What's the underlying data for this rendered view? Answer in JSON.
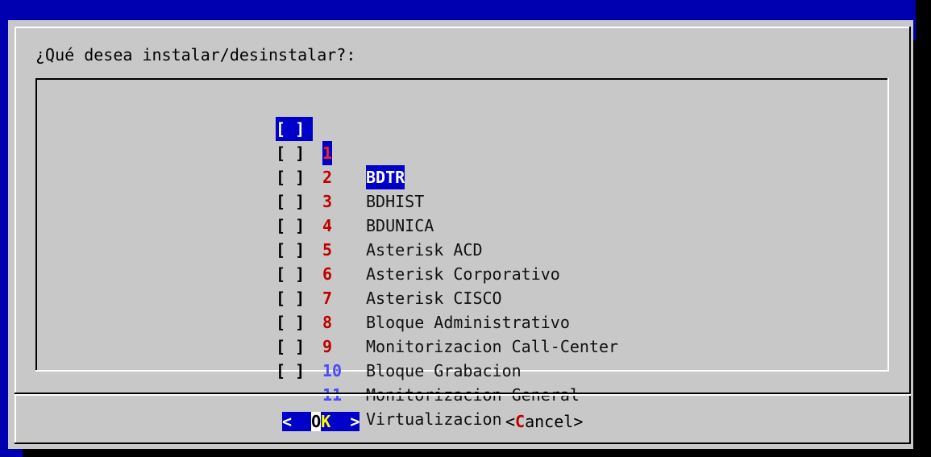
{
  "dialog": {
    "prompt": "¿Qué desea instalar/desinstalar?:"
  },
  "checklist": {
    "items": [
      {
        "check": "[ ]",
        "tag": "1",
        "label": "BDTR"
      },
      {
        "check": "[ ]",
        "tag": "2",
        "label": "BDHIST"
      },
      {
        "check": "[ ]",
        "tag": "3",
        "label": "BDUNICA"
      },
      {
        "check": "[ ]",
        "tag": "4",
        "label": "Asterisk ACD"
      },
      {
        "check": "[ ]",
        "tag": "5",
        "label": "Asterisk Corporativo"
      },
      {
        "check": "[ ]",
        "tag": "6",
        "label": "Asterisk CISCO"
      },
      {
        "check": "[ ]",
        "tag": "7",
        "label": "Bloque Administrativo"
      },
      {
        "check": "[ ]",
        "tag": "8",
        "label": "Monitorizacion Call-Center"
      },
      {
        "check": "[ ]",
        "tag": "9",
        "label": "Bloque Grabacion"
      },
      {
        "check": "[ ]",
        "tag": "10",
        "label": "Monitorizacion General"
      },
      {
        "check": "[ ]",
        "tag": "11",
        "label": "Virtualizacion"
      }
    ]
  },
  "buttons": {
    "ok": {
      "left": "<",
      "o": "O",
      "k": "K",
      "right": ">"
    },
    "cancel": {
      "open": "<",
      "c": "C",
      "rest": "ancel",
      "close": ">"
    }
  },
  "colors": {
    "background": "#0000b0",
    "dialog": "#c8c8c8",
    "tag": "#c00000",
    "tag_highlight": "#4a4aff",
    "selection": "#0000c8"
  }
}
